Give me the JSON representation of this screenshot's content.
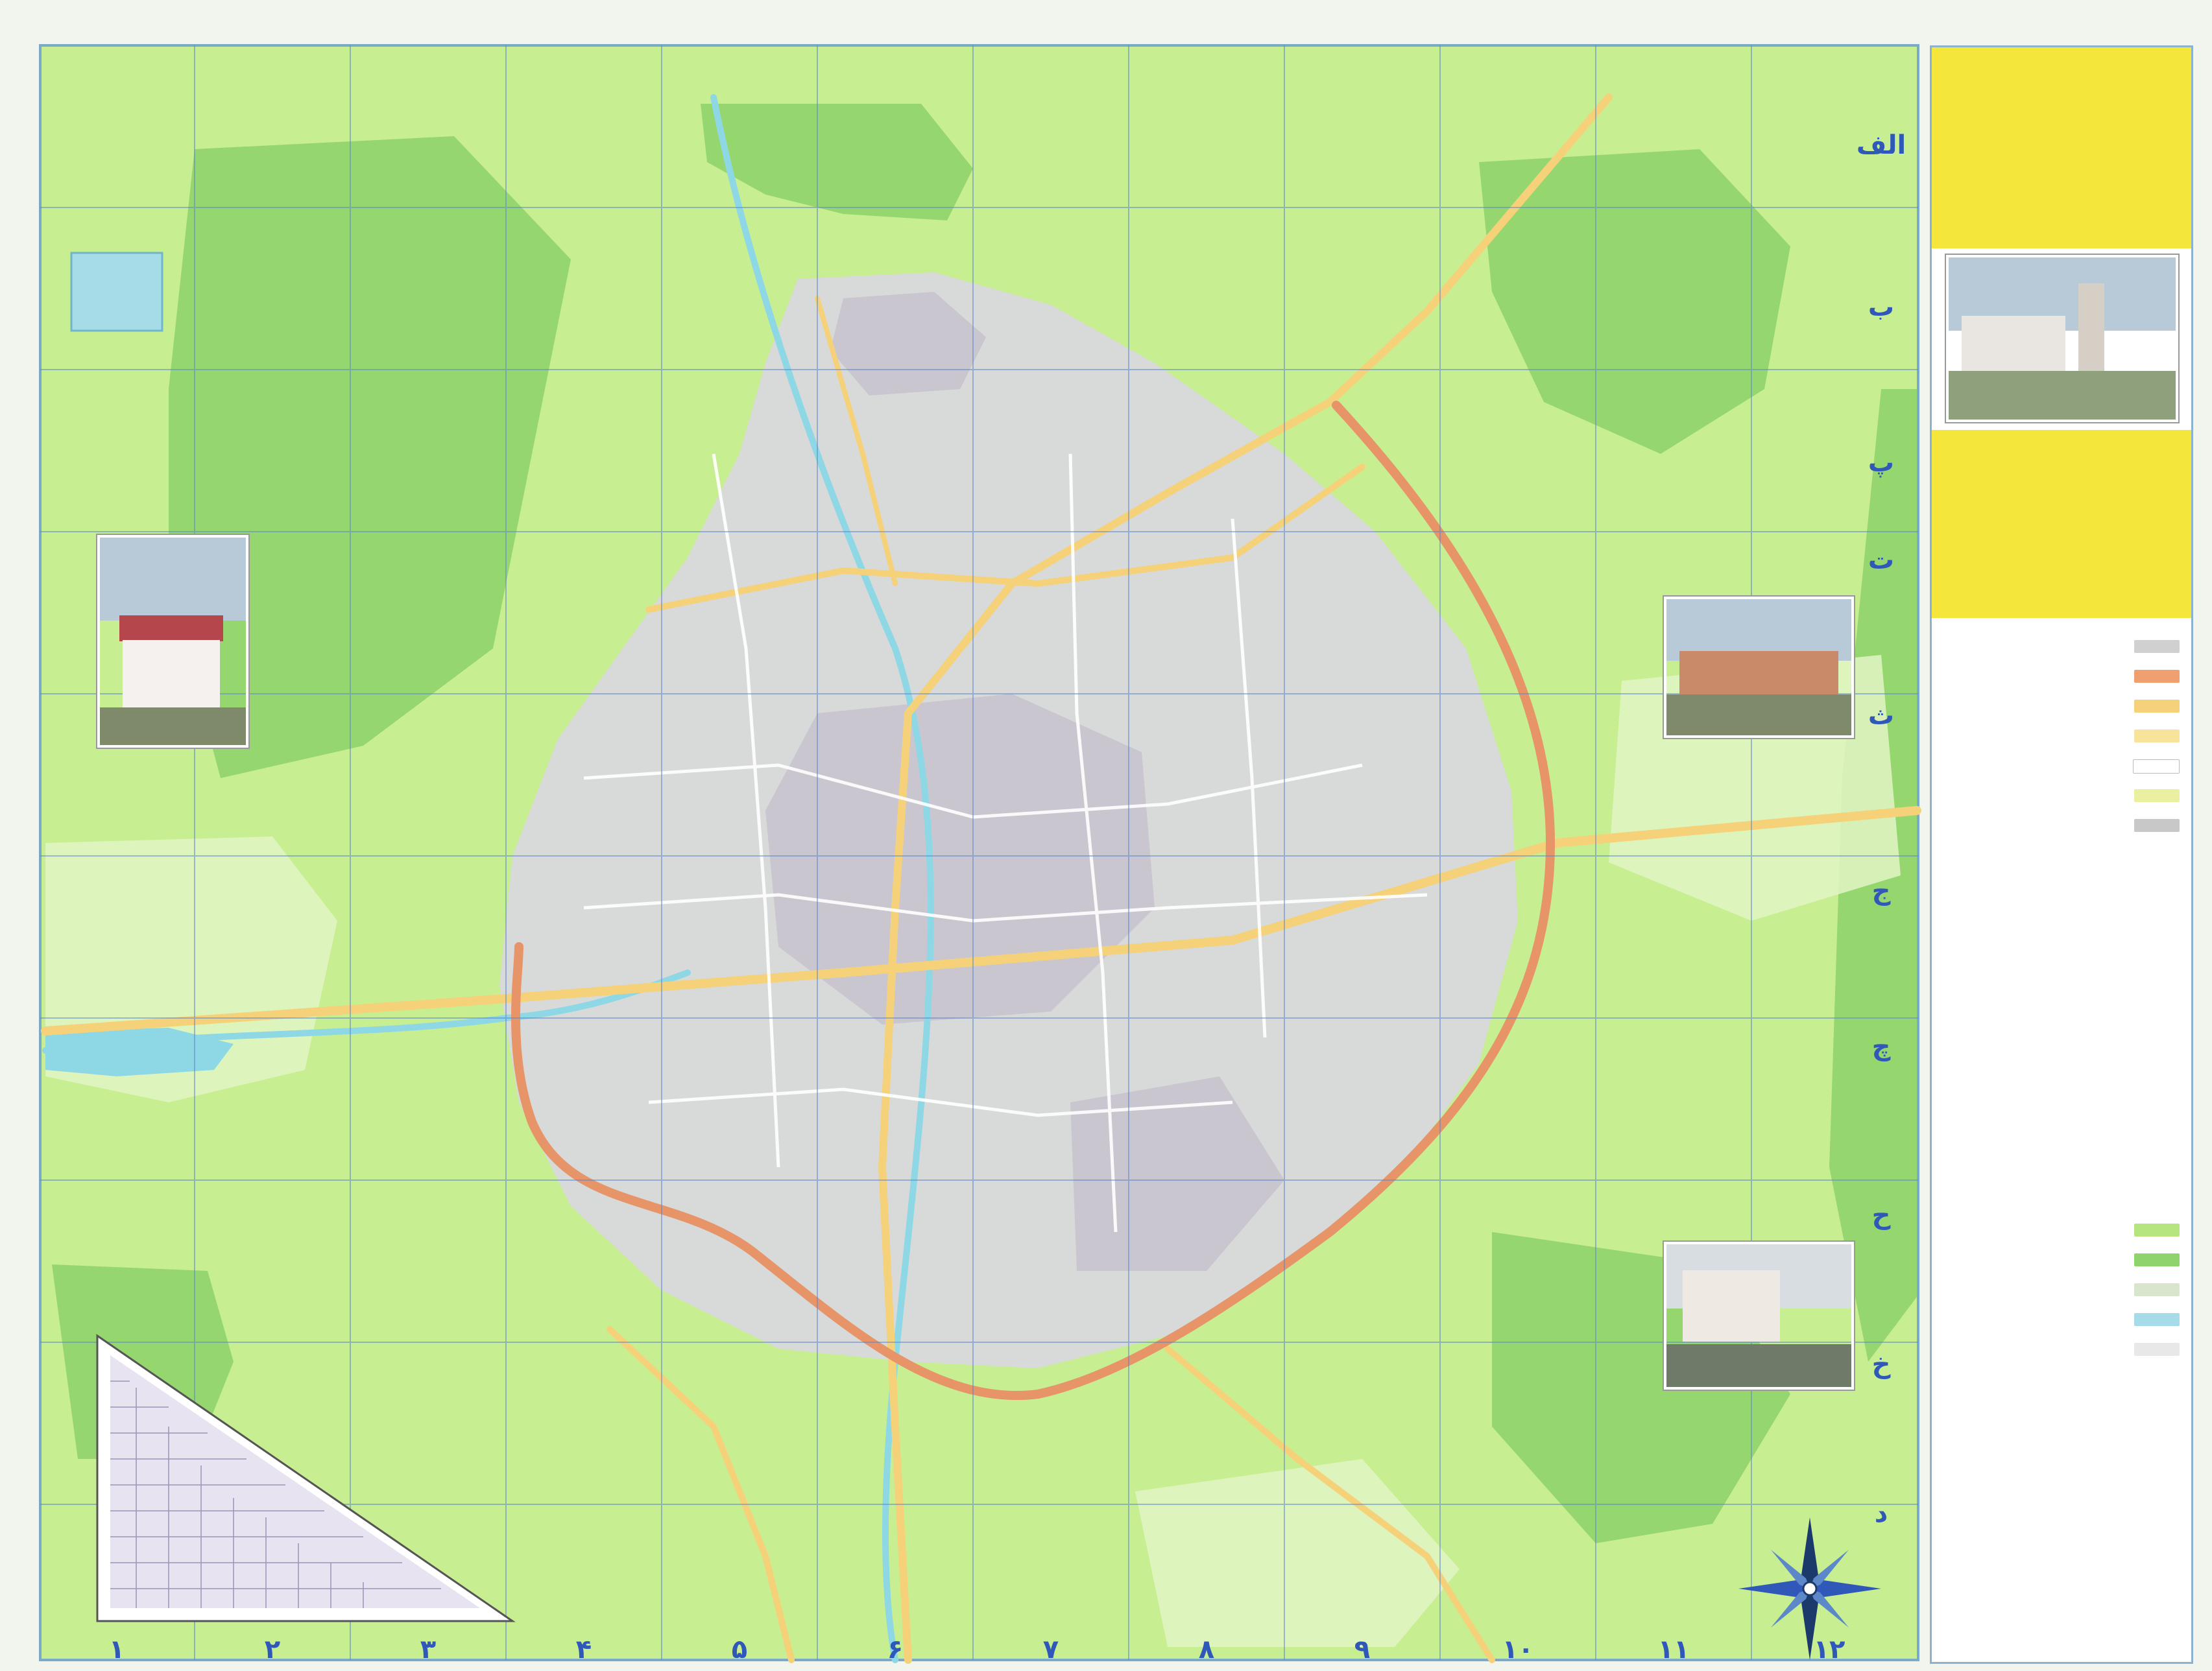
{
  "map": {
    "title": "",
    "subtitle": "",
    "publisher": "",
    "year": ""
  },
  "grid": {
    "columns": [
      "۱",
      "۲",
      "۳",
      "۴",
      "۵",
      "۶",
      "۷",
      "۸",
      "۹",
      "۱۰",
      "۱۱",
      "۱۲"
    ],
    "rows": [
      "الف",
      "ب",
      "پ",
      "ت",
      "ث",
      "ج",
      "چ",
      "ح",
      "خ",
      "د"
    ]
  },
  "legend": {
    "heading": "",
    "road_classes": [
      {
        "label": "",
        "color": "#d0d0d0"
      },
      {
        "label": "",
        "color": "#f0a070"
      },
      {
        "label": "",
        "color": "#f5d27a"
      },
      {
        "label": "",
        "color": "#f7e49a"
      },
      {
        "label": "",
        "color": "#ffffff"
      },
      {
        "label": "",
        "color": "#eaf0a0"
      },
      {
        "label": "",
        "color": "#c8c8c8"
      }
    ],
    "land_use": [
      {
        "label": "",
        "color": "#b6e47e"
      },
      {
        "label": "",
        "color": "#8fd46a"
      },
      {
        "label": "",
        "color": "#d9e6ce"
      },
      {
        "label": "",
        "color": "#a6dbe8"
      },
      {
        "label": "",
        "color": "#e8e8e8"
      }
    ]
  },
  "colors": {
    "built_up": "#d9d7dd",
    "green_area": "#c8ee92",
    "forest": "#8fd46a",
    "ring_road": "#e69468",
    "main_road": "#f5d27a",
    "water": "#8ed8e6",
    "legend_panel_top": "#f5e63b"
  }
}
